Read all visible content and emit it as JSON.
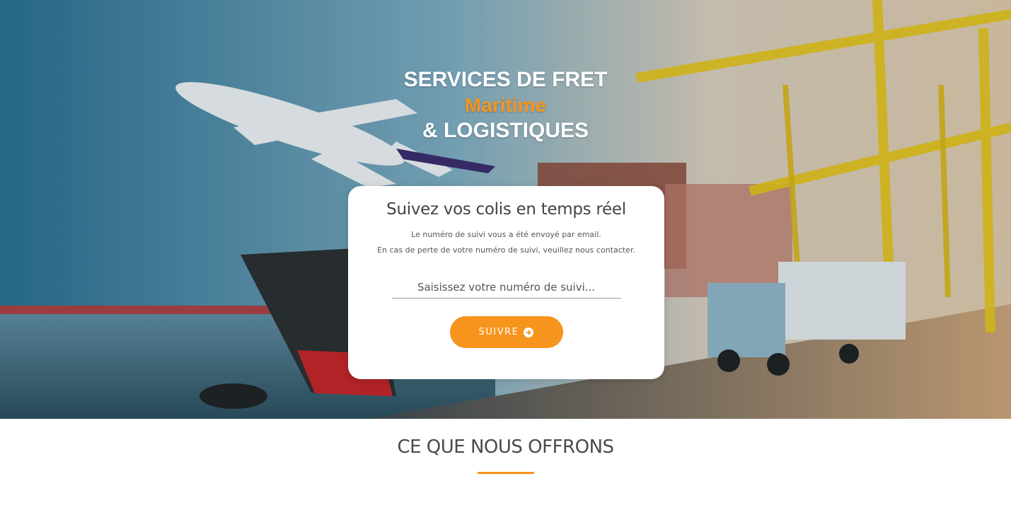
{
  "hero": {
    "title_line1": "SERVICES DE FRET",
    "title_line2": "Maritime",
    "title_line3": "& LOGISTIQUES"
  },
  "tracking": {
    "heading": "Suivez vos colis en temps réel",
    "note_line1": "Le numéro de suivi vous a été envoyé par email.",
    "note_line2": "En cas de perte de votre numéro de suivi, veuillez nous contacter.",
    "input_placeholder": "Saisissez votre numéro de suivi...",
    "input_value": "",
    "button_label": "SUIVRE",
    "button_icon": "arrow-circle-right-icon"
  },
  "offers": {
    "heading": "CE QUE NOUS OFFRONS"
  },
  "colors": {
    "accent": "#f7941d",
    "heading_text": "#444444",
    "card_bg": "#ffffff"
  }
}
